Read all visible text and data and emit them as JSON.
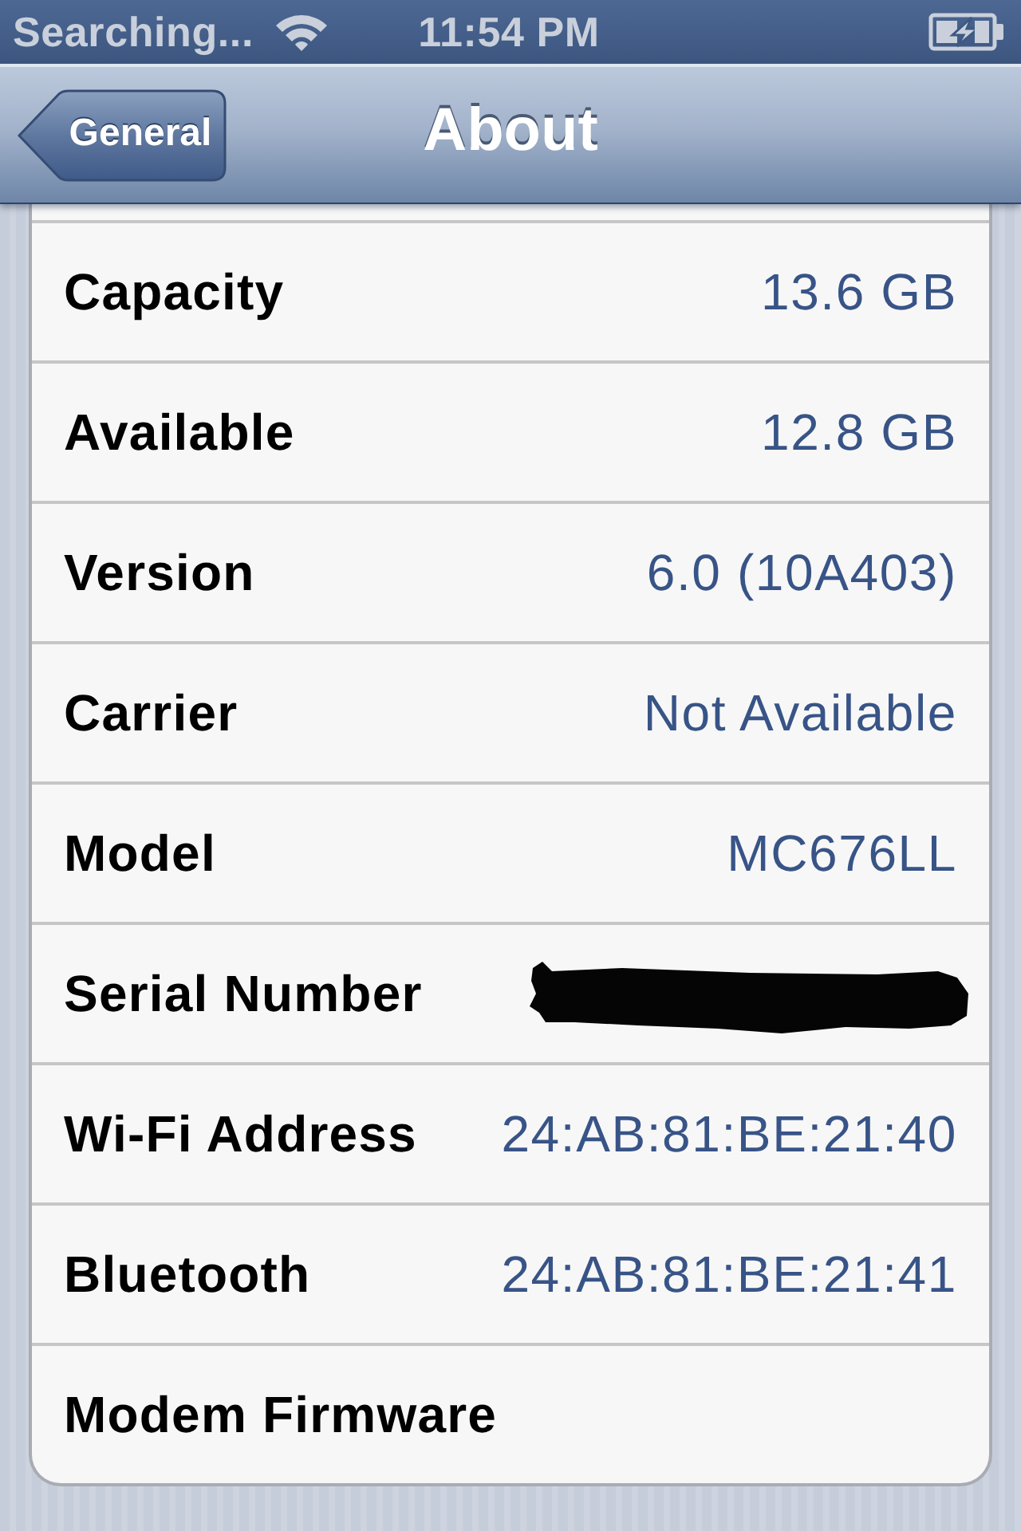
{
  "status_bar": {
    "carrier": "Searching...",
    "time": "11:54 PM",
    "battery": {
      "charging": true
    }
  },
  "nav_bar": {
    "back_button": "General",
    "title": "About"
  },
  "rows": [
    {
      "kind": "value",
      "label": "Capacity",
      "value": "13.6 GB"
    },
    {
      "kind": "value",
      "label": "Available",
      "value": "12.8 GB"
    },
    {
      "kind": "value",
      "label": "Version",
      "value": "6.0 (10A403)"
    },
    {
      "kind": "value",
      "label": "Carrier",
      "value": "Not Available"
    },
    {
      "kind": "value",
      "label": "Model",
      "value": "MC676LL"
    },
    {
      "kind": "redacted",
      "label": "Serial Number"
    },
    {
      "kind": "value",
      "label": "Wi-Fi Address",
      "value": "24:AB:81:BE:21:40"
    },
    {
      "kind": "value",
      "label": "Bluetooth",
      "value": "24:AB:81:BE:21:41"
    },
    {
      "kind": "empty",
      "label": "Modem Firmware"
    }
  ]
}
